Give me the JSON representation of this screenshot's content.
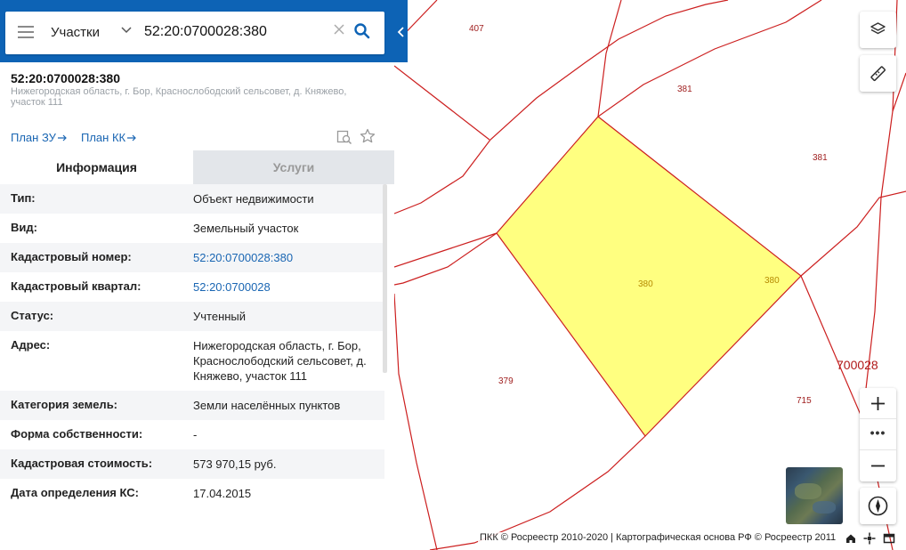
{
  "search": {
    "scope": "Участки",
    "query": "52:20:0700028:380"
  },
  "object": {
    "number": "52:20:0700028:380",
    "address": "Нижегородская область, г. Бор, Краснослободский сельсовет, д. Княжево, участок 111",
    "links": {
      "plan_zu": "План ЗУ",
      "plan_kk": "План КК"
    }
  },
  "tabs": {
    "info": "Информация",
    "services": "Услуги"
  },
  "rows": [
    {
      "key": "Тип:",
      "value": "Объект недвижимости"
    },
    {
      "key": "Вид:",
      "value": "Земельный участок"
    },
    {
      "key": "Кадастровый номер:",
      "value": "52:20:0700028:380"
    },
    {
      "key": "Кадастровый квартал:",
      "value": "52:20:0700028"
    },
    {
      "key": "Статус:",
      "value": "Учтенный"
    },
    {
      "key": "Адрес:",
      "value": "Нижегородская область, г. Бор, Краснослободский сельсовет, д. Княжево, участок 111"
    },
    {
      "key": "Категория земель:",
      "value": "Земли населённых пунктов"
    },
    {
      "key": "Форма собственности:",
      "value": "-"
    },
    {
      "key": "Кадастровая стоимость:",
      "value": "573 970,15 руб."
    },
    {
      "key": "Дата определения КС:",
      "value": "17.04.2015"
    }
  ],
  "map": {
    "labels": {
      "l407": "407",
      "l381a": "381",
      "l381b": "381",
      "l380a": "380",
      "l380b": "380",
      "l379": "379",
      "l715": "715"
    },
    "block": "700028",
    "zoom_dots": "•••",
    "attribution": "ПКК © Росреестр 2010-2020 | Картографическая основа РФ © Росреестр 2011"
  },
  "colors": {
    "header": "#0d63b5",
    "link": "#1a66b3",
    "parcel_border": "#cc1f1f",
    "selected_fill": "#ffff80"
  }
}
